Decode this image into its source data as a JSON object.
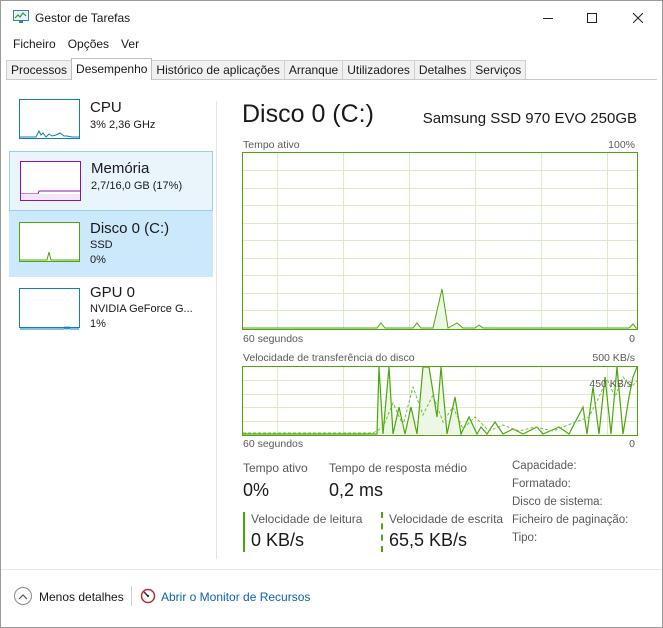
{
  "window": {
    "title": "Gestor de Tarefas"
  },
  "menu": [
    "Ficheiro",
    "Opções",
    "Ver"
  ],
  "tabs": [
    "Processos",
    "Desempenho",
    "Histórico de aplicações",
    "Arranque",
    "Utilizadores",
    "Detalhes",
    "Serviços"
  ],
  "active_tab": "Desempenho",
  "resources": [
    {
      "name": "CPU",
      "sub1": "3% 2,36 GHz",
      "sub2": "",
      "color": "#117dbb"
    },
    {
      "name": "Memória",
      "sub1": "2,7/16,0 GB (17%)",
      "sub2": "",
      "color": "#8b12ae"
    },
    {
      "name": "Disco 0 (C:)",
      "sub1": "SSD",
      "sub2": "0%",
      "color": "#4da60c"
    },
    {
      "name": "GPU 0",
      "sub1": "NVIDIA GeForce G...",
      "sub2": "1%",
      "color": "#117dbb"
    }
  ],
  "disk": {
    "title": "Disco 0 (C:)",
    "model": "Samsung SSD 970 EVO 250GB",
    "active_graph": {
      "label": "Tempo ativo",
      "max_label": "100%",
      "time_label": "60 segundos",
      "min_label": "0"
    },
    "transfer_graph": {
      "label": "Velocidade de transferência do disco",
      "max_label": "500 KB/s",
      "secondary_label": "450 KB/s",
      "time_label": "60 segundos",
      "min_label": "0"
    },
    "stats": {
      "active_time_label": "Tempo ativo",
      "active_time_value": "0%",
      "response_label": "Tempo de resposta médio",
      "response_value": "0,2 ms",
      "read_label": "Velocidade de leitura",
      "read_value": "0 KB/s",
      "write_label": "Velocidade de escrita",
      "write_value": "65,5 KB/s"
    },
    "properties": [
      "Capacidade:",
      "Formatado:",
      "Disco de sistema:",
      "Ficheiro de paginação:",
      "Tipo:"
    ]
  },
  "footer": {
    "less_details": "Menos detalhes",
    "open_monitor": "Abrir o Monitor de Recursos"
  },
  "colors": {
    "disk_green": "#4da60c",
    "cpu_blue": "#117dbb",
    "memory_purple": "#8b12ae",
    "link_blue": "#0a63b4"
  }
}
